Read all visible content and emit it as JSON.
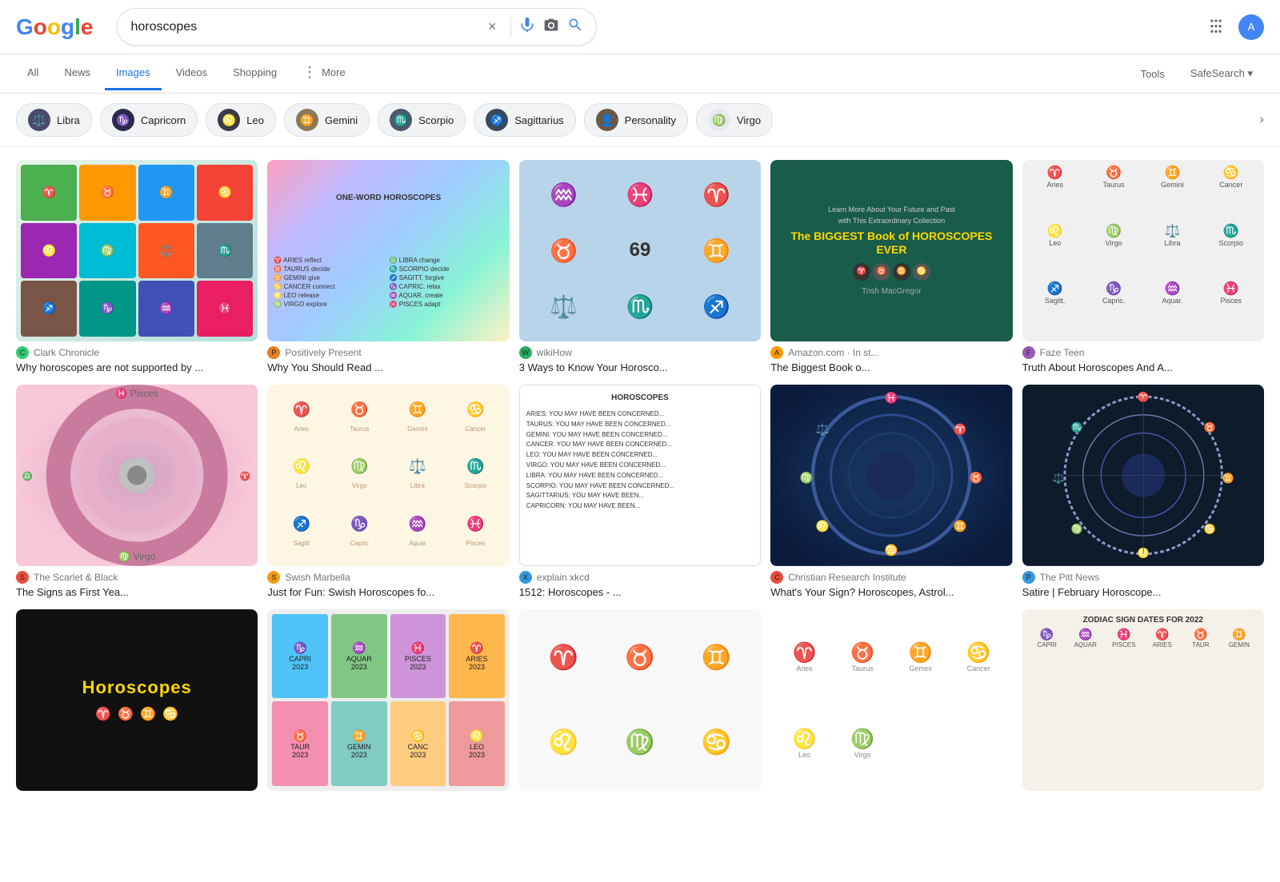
{
  "header": {
    "logo": "Google",
    "search_query": "horoscopes",
    "clear_label": "×",
    "mic_label": "🎤",
    "camera_label": "📷",
    "search_label": "🔍",
    "apps_label": "⋮⋮⋮",
    "safe_search": "SafeSearch ▾"
  },
  "nav": {
    "tabs": [
      {
        "id": "all",
        "label": "All",
        "active": false
      },
      {
        "id": "news",
        "label": "News",
        "active": false
      },
      {
        "id": "images",
        "label": "Images",
        "active": true
      },
      {
        "id": "videos",
        "label": "Videos",
        "active": false
      },
      {
        "id": "shopping",
        "label": "Shopping",
        "active": false
      },
      {
        "id": "more",
        "label": "More",
        "active": false
      }
    ],
    "tools": "Tools",
    "safe_search": "SafeSearch ▾"
  },
  "filters": [
    {
      "id": "libra",
      "label": "Libra",
      "emoji": "⚖️",
      "bg": "#4a4a6a"
    },
    {
      "id": "capricorn",
      "label": "Capricorn",
      "emoji": "♑",
      "bg": "#2a2a3a"
    },
    {
      "id": "leo",
      "label": "Leo",
      "emoji": "♌",
      "bg": "#3a3a4a"
    },
    {
      "id": "gemini",
      "label": "Gemini",
      "emoji": "♊",
      "bg": "#8a7a5a"
    },
    {
      "id": "scorpio",
      "label": "Scorpio",
      "emoji": "♏",
      "bg": "#4a5a6a"
    },
    {
      "id": "sagittarius",
      "label": "Sagittarius",
      "emoji": "♐",
      "bg": "#3a4a5a"
    },
    {
      "id": "personality",
      "label": "Personality",
      "emoji": "👤",
      "bg": "#6a5a4a"
    },
    {
      "id": "virgo",
      "label": "Virgo",
      "emoji": "♍",
      "bg": "#e8e8f0"
    }
  ],
  "results": {
    "row1": [
      {
        "id": "r1c1",
        "source_name": "Clark Chronicle",
        "source_color": "#2ecc71",
        "title": "Why horoscopes are not supported by ...",
        "bg": "colorful",
        "content": "zodiac-grid"
      },
      {
        "id": "r1c2",
        "source_name": "Positively Present",
        "source_color": "#e67e22",
        "title": "Why You Should Read ...",
        "bg": "rainbow",
        "content": "ONE-WORD HOROSCOPES"
      },
      {
        "id": "r1c3",
        "source_name": "wikiHow",
        "source_color": "#27ae60",
        "title": "3 Ways to Know Your Horosco...",
        "bg": "lightblue",
        "content": "symbols"
      },
      {
        "id": "r1c4",
        "source_name": "Amazon.com · In st...",
        "source_color": "#e67e22",
        "title": "The Biggest Book o...",
        "bg": "teal",
        "content": "BIGGEST Book of HOROSCOPES EVER"
      },
      {
        "id": "r1c5",
        "source_name": "Faze Teen",
        "source_color": "#9b59b6",
        "title": "Truth About Horoscopes And A...",
        "bg": "multicolor",
        "content": "zodiac-grid-2"
      }
    ],
    "row2": [
      {
        "id": "r2c1",
        "source_name": "The Scarlet & Black",
        "source_color": "#e74c3c",
        "title": "The Signs as First Yea...",
        "bg": "pink-wheel",
        "content": "wheel"
      },
      {
        "id": "r2c2",
        "source_name": "Swish Marbella",
        "source_color": "#f39c12",
        "title": "Just for Fun: Swish Horoscopes fo...",
        "bg": "cream",
        "content": "zodiac-sketches"
      },
      {
        "id": "r2c3",
        "source_name": "explain xkcd",
        "source_color": "#3498db",
        "title": "1512: Horoscopes - ...",
        "bg": "text-white",
        "content": "HOROSCOPES text"
      },
      {
        "id": "r2c4",
        "source_name": "Christian Research Institute",
        "source_color": "#e74c3c",
        "title": "What's Your Sign? Horoscopes, Astrol...",
        "bg": "space-blue",
        "content": "blue-wheel"
      },
      {
        "id": "r2c5",
        "source_name": "The Pitt News",
        "source_color": "#3498db",
        "title": "Satire | February Horoscope...",
        "bg": "dark-blue",
        "content": "white-wheel"
      }
    ],
    "row3": [
      {
        "id": "r3c1",
        "source_name": "",
        "title": "",
        "bg": "black",
        "content": "Horoscopes dark"
      },
      {
        "id": "r3c2",
        "source_name": "",
        "title": "",
        "bg": "colored-cards",
        "content": "zodiac cards"
      },
      {
        "id": "r3c3",
        "source_name": "",
        "title": "",
        "bg": "white-zodiac",
        "content": "zodiac outlines"
      },
      {
        "id": "r3c4",
        "source_name": "",
        "title": "",
        "bg": "line-art",
        "content": "zodiac line art"
      },
      {
        "id": "r3c5",
        "source_name": "",
        "title": "",
        "bg": "zodiac-dates",
        "content": "zodiac dates 2022"
      }
    ]
  }
}
